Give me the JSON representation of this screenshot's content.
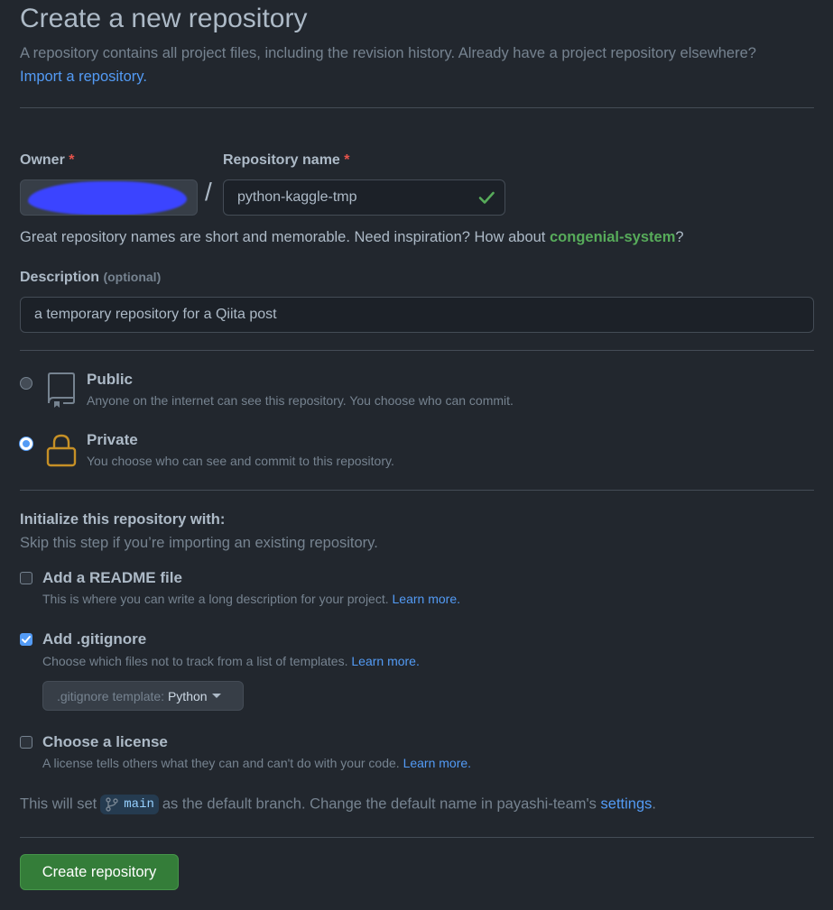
{
  "page": {
    "title": "Create a new repository",
    "lead": "A repository contains all project files, including the revision history. Already have a project repository elsewhere?",
    "import_link": "Import a repository."
  },
  "owner": {
    "label": "Owner",
    "required_mark": "*"
  },
  "repo_name": {
    "label": "Repository name",
    "required_mark": "*",
    "value": "python-kaggle-tmp",
    "valid_icon": "check-icon",
    "hint_prefix": "Great repository names are short and memorable. Need inspiration? How about",
    "suggestion": "congenial-system",
    "hint_suffix": "?"
  },
  "slash": "/",
  "description": {
    "label": "Description",
    "optional": "(optional)",
    "value": "a temporary repository for a Qiita post"
  },
  "visibility": {
    "public": {
      "title": "Public",
      "desc": "Anyone on the internet can see this repository. You choose who can commit.",
      "icon": "repo-icon",
      "selected": false
    },
    "private": {
      "title": "Private",
      "desc": "You choose who can see and commit to this repository.",
      "icon": "lock-icon",
      "selected": true
    }
  },
  "init": {
    "heading": "Initialize this repository with:",
    "subheading": "Skip this step if you’re importing an existing repository.",
    "readme": {
      "title": "Add a README file",
      "desc": "This is where you can write a long description for your project.",
      "link": "Learn more.",
      "checked": false
    },
    "gitignore": {
      "title": "Add .gitignore",
      "desc": "Choose which files not to track from a list of templates.",
      "link": "Learn more.",
      "checked": true,
      "select_prefix": ".gitignore template:",
      "select_value": "Python"
    },
    "license": {
      "title": "Choose a license",
      "desc": "A license tells others what they can and can't do with your code.",
      "link": "Learn more.",
      "checked": false
    }
  },
  "branch": {
    "prefix": "This will set",
    "name": "main",
    "middle": "as the default branch. Change the default name in payashi-team's",
    "link": "settings",
    "suffix": "."
  },
  "submit": {
    "label": "Create repository"
  },
  "colors": {
    "accent": "#539bf5",
    "success": "#347d39",
    "suggestion": "#57ab5a",
    "warning_icon": "#c69026",
    "danger": "#e5534b"
  }
}
